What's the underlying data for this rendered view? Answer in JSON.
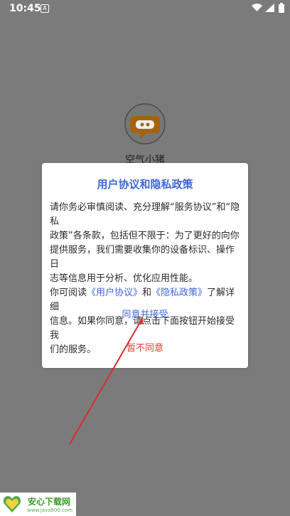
{
  "status_bar": {
    "time": "10:45",
    "notification_letter": "A"
  },
  "app": {
    "name": "空气小猪"
  },
  "dialog": {
    "title": "用户协议和隐私政策",
    "body_line1": "请你务必审慎阅读、充分理解“服务协议”和“隐私",
    "body_line2": "政策”各条款，包括但不限于：为了更好的向你",
    "body_line3": "提供服务，我们需要收集你的设备标识、操作日",
    "body_line4": "志等信息用于分析、优化应用性能。",
    "body_line5_prefix": "你可阅读",
    "user_agreement_link": "《用户协议》",
    "body_line5_and": "和",
    "privacy_policy_link": "《隐私政策》",
    "body_line5_suffix": "了解详细",
    "body_line6": "信息。如果你同意，请点击下面按钮开始接受我",
    "body_line7": "们的服务。",
    "agree_label": "同意并接受",
    "disagree_label": "暂不同意"
  },
  "watermark": {
    "title": "安心下载网",
    "url": "www.java800.com",
    "logo_text": "安心\n网"
  },
  "colors": {
    "link_blue": "#3f67d8",
    "disagree_red": "#d33f2f",
    "overlay_gray": "#7b7b7b",
    "arrow_red": "#dd2c2c"
  }
}
